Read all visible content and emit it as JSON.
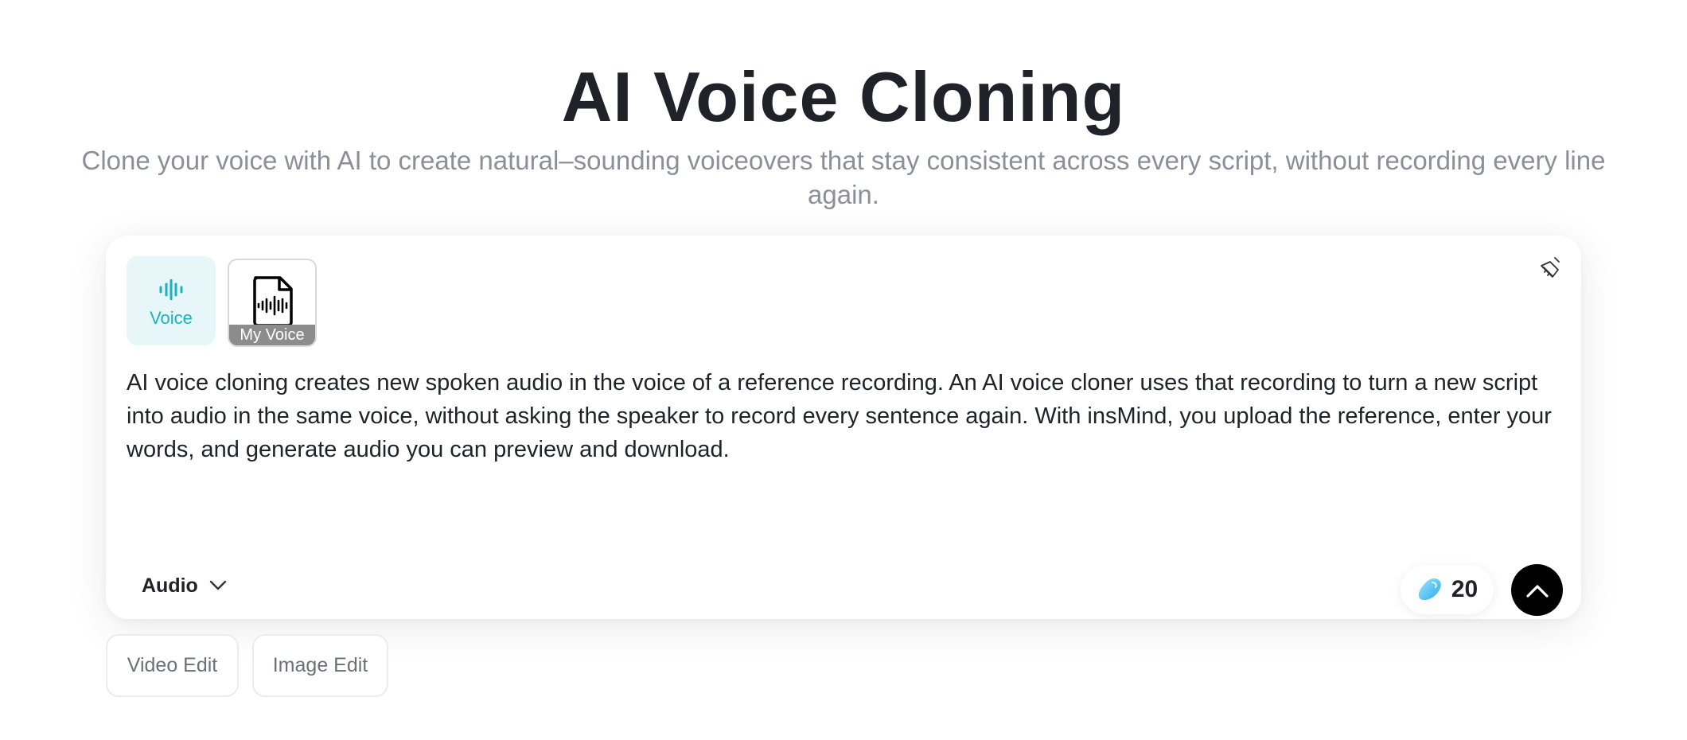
{
  "hero": {
    "title": "AI Voice Cloning",
    "subtitle": "Clone your voice with AI to create natural–sounding voiceovers that stay consistent across every script, without recording every line again."
  },
  "composer": {
    "modes": [
      {
        "label": "Voice",
        "icon": "sound-wave-icon",
        "selected": true
      },
      {
        "label": "My Voice",
        "icon": "audio-file-icon",
        "selected": false
      }
    ],
    "clear_icon": "broom-icon",
    "script_text": "AI voice cloning creates new spoken audio in the voice of a reference recording. An AI voice cloner uses that recording to turn a new script into audio in the same voice, without asking the speaker to record every sentence again. With insMind, you upload the reference, enter your words, and generate audio you can preview and download.",
    "output_type": {
      "label": "Audio",
      "icon": "chevron-down-icon"
    },
    "credits": {
      "value": "20",
      "icon": "credit-gem-icon"
    },
    "submit_icon": "arrow-up-icon"
  },
  "quick_chips": [
    "Video Edit",
    "Image Edit"
  ],
  "colors": {
    "accent": "#1fb0c4",
    "accent_bg": "#e7f6f9",
    "title_text": "#1f2329",
    "muted_text": "#8a8f99",
    "submit_bg": "#000000"
  }
}
